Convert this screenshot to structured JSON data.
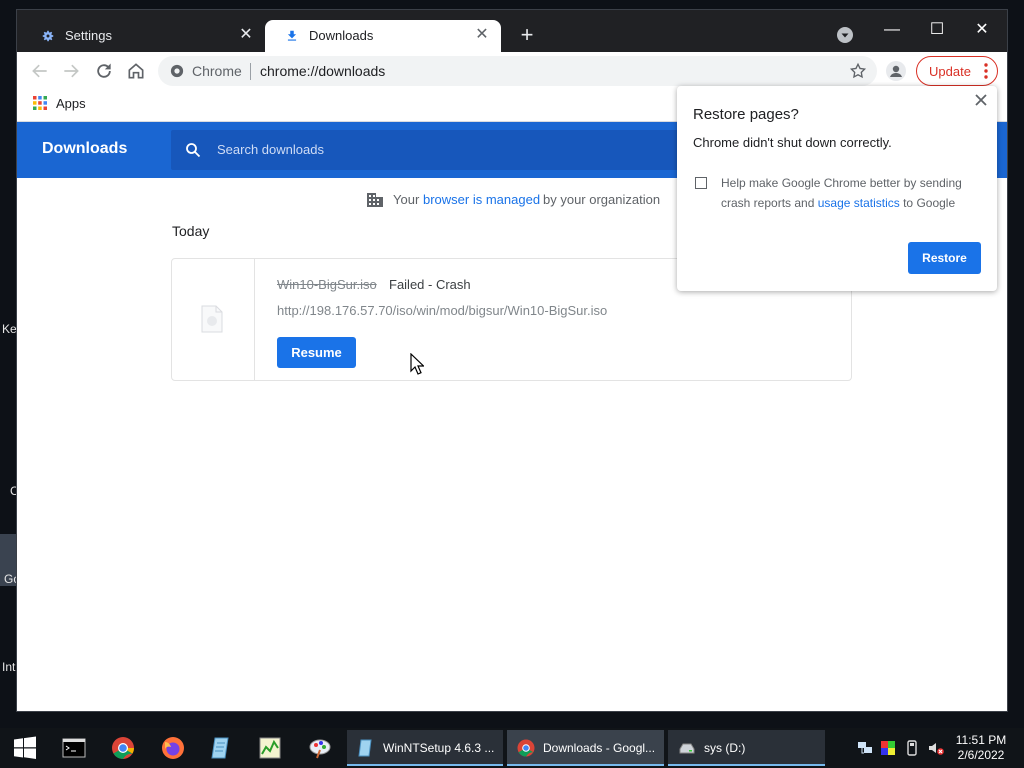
{
  "desktop": {
    "edge_labels": [
      "Key",
      "C",
      "Go",
      "Int"
    ]
  },
  "browser": {
    "tabs": [
      {
        "title": "Settings",
        "active": false,
        "icon": "gear-icon"
      },
      {
        "title": "Downloads",
        "active": true,
        "icon": "download-icon"
      }
    ],
    "new_tab": "+",
    "window_controls": {
      "minimize": "—",
      "maximize": "☐",
      "close": "✕"
    },
    "toolbar": {
      "chip": "Chrome",
      "url": "chrome://downloads",
      "update_label": "Update"
    },
    "bookmarks": {
      "apps_label": "Apps"
    }
  },
  "downloads_page": {
    "title": "Downloads",
    "search_placeholder": "Search downloads",
    "managed_notice": {
      "prefix": "Your",
      "link": "browser is managed",
      "suffix": "by your organization"
    },
    "section": "Today",
    "items": [
      {
        "filename": "Win10-BigSur.iso",
        "status": "Failed - Crash",
        "url": "http://198.176.57.70/iso/win/mod/bigsur/Win10-BigSur.iso",
        "action": "Resume"
      }
    ]
  },
  "restore_bubble": {
    "title": "Restore pages?",
    "message": "Chrome didn't shut down correctly.",
    "option_prefix": "Help make Google Chrome better by sending crash reports and ",
    "option_link": "usage statistics",
    "option_suffix": " to Google",
    "checked": false,
    "button": "Restore"
  },
  "taskbar": {
    "tasks": [
      {
        "label": "WinNTSetup 4.6.3 ...",
        "icon": "winntsetup-icon"
      },
      {
        "label": "Downloads - Googl...",
        "icon": "chrome-icon"
      },
      {
        "label": "sys (D:)",
        "icon": "drive-icon"
      }
    ],
    "clock": {
      "time": "11:51 PM",
      "date": "2/6/2022"
    }
  },
  "colors": {
    "accent": "#1a73e8",
    "header": "#1a66d2",
    "update": "#d93025",
    "titlebar": "#202124"
  }
}
